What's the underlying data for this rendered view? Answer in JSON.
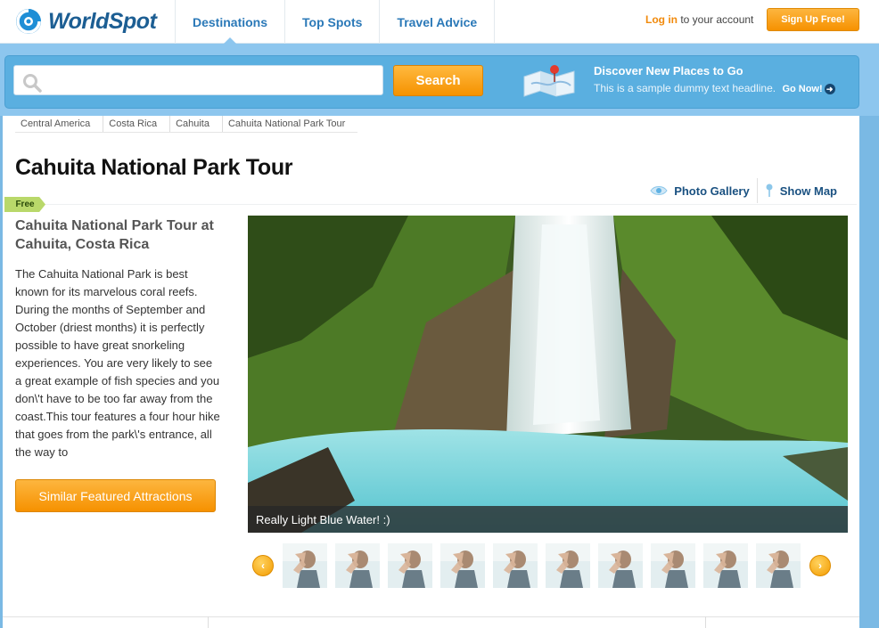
{
  "brand": {
    "name": "WorldSpot"
  },
  "nav": [
    {
      "label": "Destinations"
    },
    {
      "label": "Top Spots"
    },
    {
      "label": "Travel Advice"
    }
  ],
  "account": {
    "login_label": "Log in",
    "suffix": "to your account",
    "signup_label": "Sign Up Free!"
  },
  "search": {
    "placeholder": "",
    "button_label": "Search"
  },
  "promo": {
    "title": "Discover New Places to Go",
    "subtitle": "This is a sample dummy text headline.",
    "link_label": "Go Now!"
  },
  "breadcrumb": [
    "Central America",
    "Costa Rica",
    "Cahuita",
    "Cahuita National Park Tour"
  ],
  "page": {
    "title": "Cahuita National Park Tour",
    "tag": "Free",
    "subtitle": "Cahuita National Park Tour at Cahuita, Costa Rica",
    "description": "The Cahuita National Park is best known for its marvelous coral reefs. During the months of September and October (driest months) it is perfectly possible to have great snorkeling experiences. You are very likely to  see a great example of fish species and you don\\'t have to be too far away from the coast.This tour features a four hour hike that goes from the park\\'s entrance, all the way to",
    "similar_label": "Similar Featured Attractions"
  },
  "actions": {
    "gallery_label": "Photo Gallery",
    "map_label": "Show Map"
  },
  "photo": {
    "caption": "Really Light Blue Water! :)"
  },
  "thumbnails": {
    "count_visible": 10
  },
  "colors": {
    "accent_orange": "#f69100",
    "link_blue": "#2b79b8",
    "band_blue": "#5aafe0",
    "free_green": "#b9d86a"
  }
}
